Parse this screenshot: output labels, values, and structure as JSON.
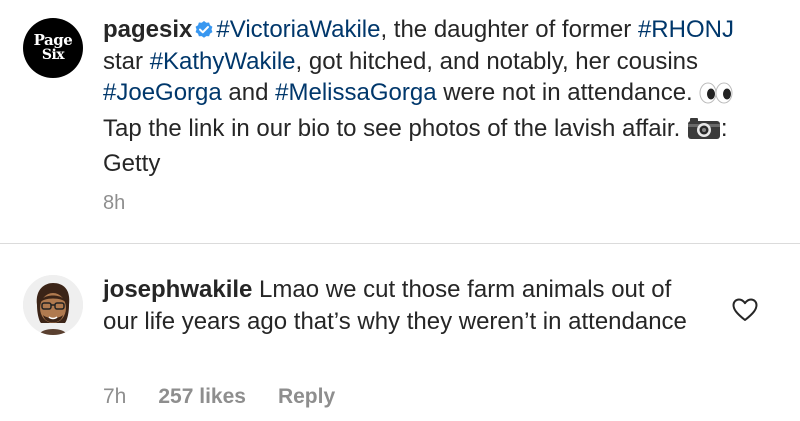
{
  "post": {
    "avatar_line1": "Page",
    "avatar_line2": "Six",
    "username": "pagesix",
    "icons": {
      "verified": "verified-badge-icon",
      "eyes": "eyes-emoji-icon",
      "camera": "camera-emoji-icon"
    },
    "caption_parts": {
      "tag1": "#VictoriaWakile",
      "t1": ", the daughter of former ",
      "tag2": "#RHONJ",
      "t2": " star ",
      "tag3": "#KathyWakile",
      "t3": ", got hitched, and notably, her cousins ",
      "tag4": "#JoeGorga",
      "t4": " and ",
      "tag5": "#MelissaGorga",
      "t5": " were not in attendance. ",
      "t6": " Tap the link in our bio to see photos of the lavish affair. ",
      "t7": ": Getty"
    },
    "time": "8h"
  },
  "comment": {
    "username": "josephwakile",
    "text": " Lmao we cut those farm animals out of our life years ago that’s why they weren’t in attendance",
    "time": "7h",
    "likes": "257 likes",
    "reply": "Reply",
    "icons": {
      "like": "heart-outline-icon",
      "avatar": "memoji-avatar"
    }
  },
  "colors": {
    "hashtag": "#00376b",
    "verified": "#3897f0",
    "meta": "#8e8e8e",
    "text": "#262626"
  }
}
